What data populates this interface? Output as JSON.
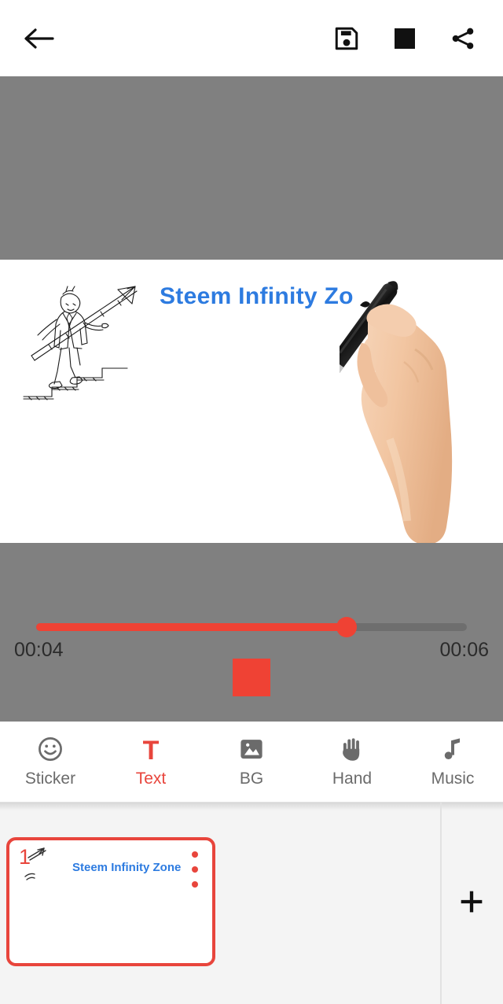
{
  "topbar": {
    "back_label": "Back",
    "save_label": "Save",
    "stop_label": "Stop",
    "share_label": "Share"
  },
  "canvas": {
    "title_text": "Steem Infinity Zo",
    "title_color": "#2d7be0",
    "background_color": "#ffffff",
    "stage_color": "#808080",
    "sketch_name": "businessman-climbing-stairs-arrow-sketch",
    "hand_name": "hand-holding-marker"
  },
  "timeline": {
    "current_time": "00:04",
    "total_time": "00:06",
    "progress_percent": 72,
    "accent_color": "#ef4234",
    "track_color": "#6e6e6e",
    "stop_button_label": "Stop playback"
  },
  "tools": {
    "items": [
      {
        "label": "Sticker",
        "icon": "smiley-icon",
        "active": false
      },
      {
        "label": "Text",
        "icon": "text-T-icon",
        "active": true
      },
      {
        "label": "BG",
        "icon": "image-icon",
        "active": false
      },
      {
        "label": "Hand",
        "icon": "hand-icon",
        "active": false
      },
      {
        "label": "Music",
        "icon": "music-note-icon",
        "active": false
      }
    ],
    "active_color": "#e8453c",
    "inactive_color": "#6b6b6b"
  },
  "strip": {
    "slides": [
      {
        "number": "1",
        "title": "Steem Infinity Zone",
        "selected": true
      }
    ],
    "add_label": "+",
    "selected_border_color": "#e8453c"
  }
}
